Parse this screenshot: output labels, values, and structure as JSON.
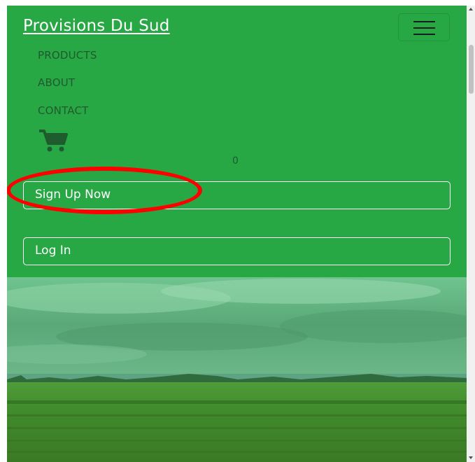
{
  "navbar": {
    "brand": "Provisions Du Sud",
    "toggler_icon": "hamburger-icon",
    "links": [
      {
        "label": "PRODUCTS"
      },
      {
        "label": "ABOUT"
      },
      {
        "label": "CONTACT"
      }
    ],
    "cart": {
      "icon": "shopping-cart-icon",
      "count": "0"
    },
    "buttons": {
      "sign_up": "Sign Up Now",
      "log_in": "Log In"
    }
  },
  "annotation": {
    "shape": "ellipse",
    "color": "#ff0000"
  },
  "colors": {
    "navbar_bg": "#28a745",
    "link": "#1e5b2d",
    "brand": "#ffffff",
    "cart": "#1e5b2d"
  },
  "hero": {
    "image": "green-field-landscape"
  }
}
